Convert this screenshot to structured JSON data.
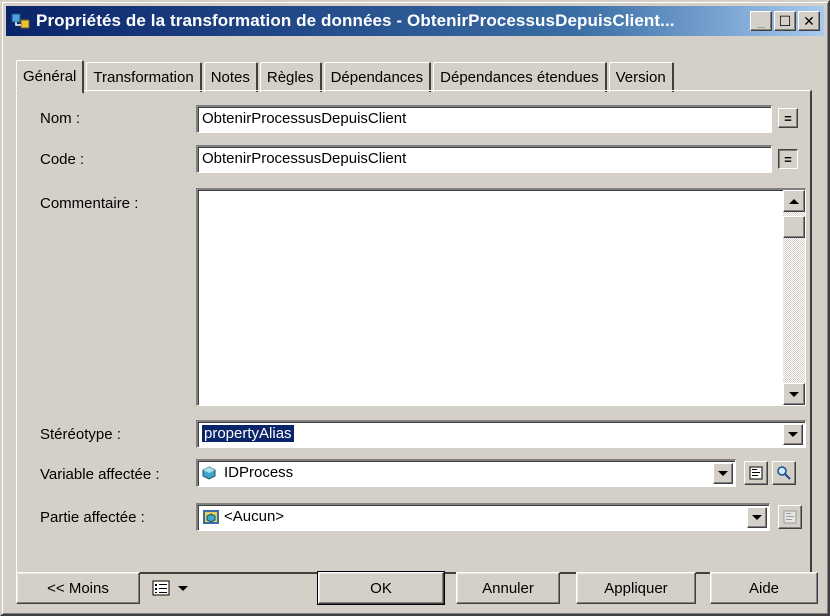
{
  "window": {
    "title": "Propriétés de la transformation de données - ObtenirProcessusDepuisClient...",
    "min_label": "_",
    "max_label": "☐",
    "close_label": "✕"
  },
  "tabs": [
    {
      "label": "Général"
    },
    {
      "label": "Transformation"
    },
    {
      "label": "Notes"
    },
    {
      "label": "Règles"
    },
    {
      "label": "Dépendances"
    },
    {
      "label": "Dépendances étendues"
    },
    {
      "label": "Version"
    }
  ],
  "form": {
    "nom_label": "Nom :",
    "nom_value": "ObtenirProcessusDepuisClient",
    "code_label": "Code :",
    "code_value": "ObtenirProcessusDepuisClient",
    "eq_button": "=",
    "commentaire_label": "Commentaire :",
    "commentaire_value": "",
    "stereotype_label": "Stéréotype :",
    "stereotype_value": "propertyAlias",
    "variable_label": "Variable affectée :",
    "variable_value": "IDProcess",
    "partie_label": "Partie affectée :",
    "partie_value": "<Aucun>"
  },
  "buttons": {
    "moins": "<< Moins",
    "ok": "OK",
    "annuler": "Annuler",
    "appliquer": "Appliquer",
    "aide": "Aide"
  },
  "colors": {
    "title_start": "#0a246a",
    "title_end": "#a6caf0",
    "selection": "#0a246a",
    "face": "#d4d0c8"
  }
}
